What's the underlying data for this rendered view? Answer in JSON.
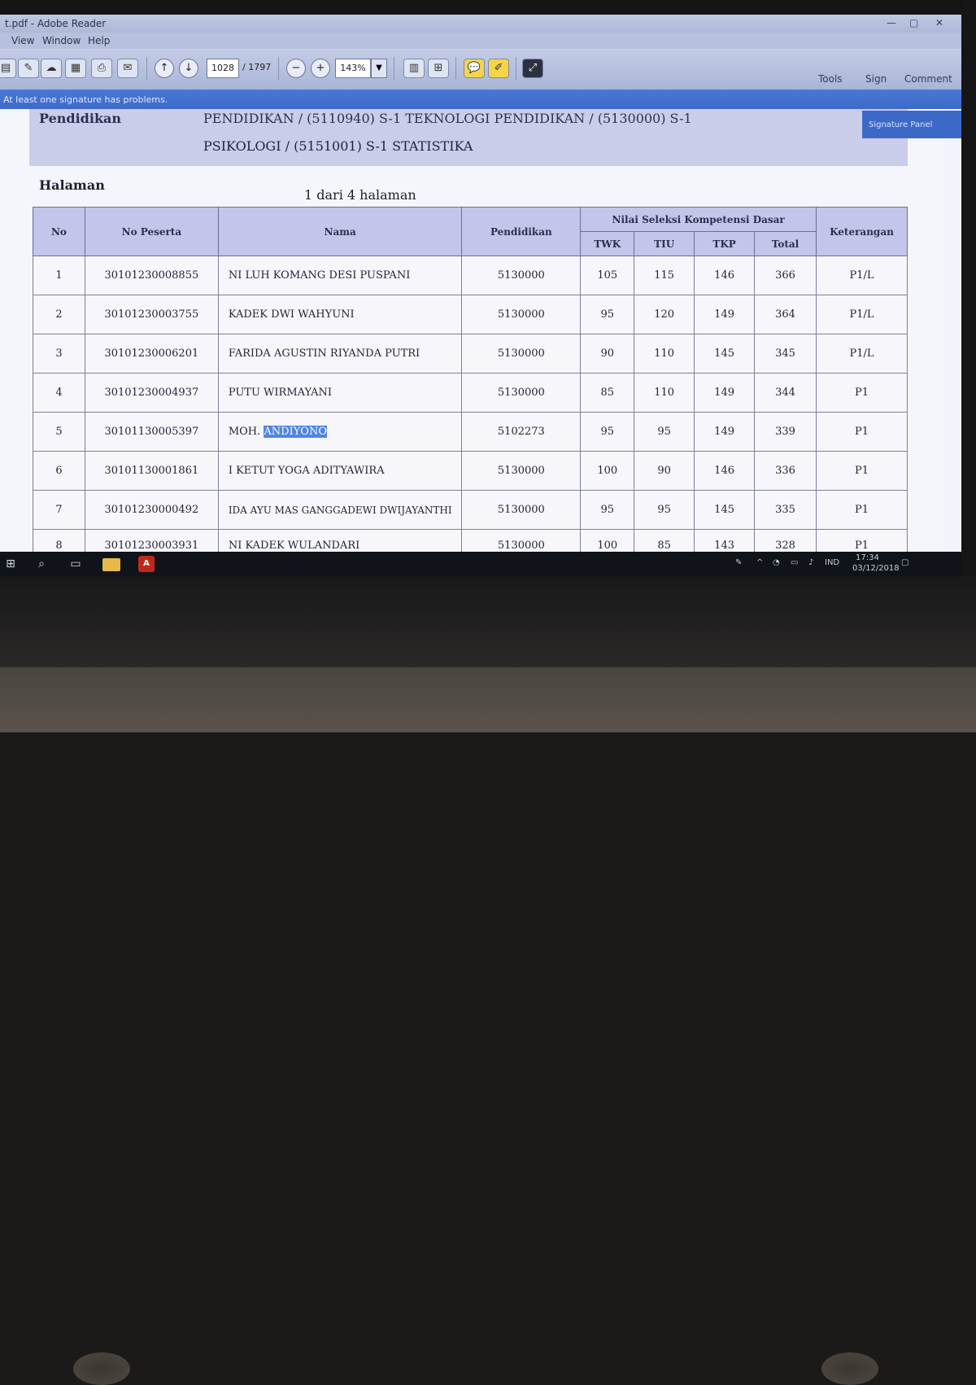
{
  "window": {
    "title": "t.pdf - Adobe Reader"
  },
  "menu": [
    "View",
    "Window",
    "Help"
  ],
  "toolbar": {
    "page_current": "1028",
    "page_total": "/ 1797",
    "zoom": "143%"
  },
  "infobar": {
    "message": "At least one signature has problems.",
    "tools": "Tools",
    "sign": "Sign",
    "comment": "Comment"
  },
  "signature_panel": {
    "label": "Signature Panel"
  },
  "document": {
    "field_label": "Pendidikan",
    "pendidikan_line1": "PENDIDIKAN / (5110940) S-1 TEKNOLOGI PENDIDIKAN / (5130000) S-1",
    "pendidikan_line2": "PSIKOLOGI / (5151001) S-1 STATISTIKA",
    "page_label": "Halaman",
    "page_value": "1    dari 4 halaman"
  },
  "table": {
    "headers": {
      "no": "No",
      "no_peserta": "No Peserta",
      "nama": "Nama",
      "pendidikan": "Pendidikan",
      "group": "Nilai Seleksi Kompetensi Dasar",
      "twk": "TWK",
      "tiu": "TIU",
      "tkp": "TKP",
      "total": "Total",
      "keterangan": "Keterangan"
    },
    "rows": [
      {
        "no": "1",
        "peserta": "30101230008855",
        "nama": "NI LUH KOMANG DESI PUSPANI",
        "pend": "5130000",
        "twk": "105",
        "tiu": "115",
        "tkp": "146",
        "total": "366",
        "ket": "P1/L"
      },
      {
        "no": "2",
        "peserta": "30101230003755",
        "nama": "KADEK DWI WAHYUNI",
        "pend": "5130000",
        "twk": "95",
        "tiu": "120",
        "tkp": "149",
        "total": "364",
        "ket": "P1/L"
      },
      {
        "no": "3",
        "peserta": "30101230006201",
        "nama": "FARIDA AGUSTIN RIYANDA PUTRI",
        "pend": "5130000",
        "twk": "90",
        "tiu": "110",
        "tkp": "145",
        "total": "345",
        "ket": "P1/L"
      },
      {
        "no": "4",
        "peserta": "30101230004937",
        "nama": "PUTU WIRMAYANI",
        "pend": "5130000",
        "twk": "85",
        "tiu": "110",
        "tkp": "149",
        "total": "344",
        "ket": "P1"
      },
      {
        "no": "5",
        "peserta": "30101130005397",
        "nama_pre": "MOH. ",
        "nama_hl": "ANDIYONO",
        "pend": "5102273",
        "twk": "95",
        "tiu": "95",
        "tkp": "149",
        "total": "339",
        "ket": "P1"
      },
      {
        "no": "6",
        "peserta": "30101130001861",
        "nama": "I KETUT YOGA ADITYAWIRA",
        "pend": "5130000",
        "twk": "100",
        "tiu": "90",
        "tkp": "146",
        "total": "336",
        "ket": "P1"
      },
      {
        "no": "7",
        "peserta": "30101230000492",
        "nama": "IDA AYU MAS GANGGADEWI DWIJAYANTHI",
        "pend": "5130000",
        "twk": "95",
        "tiu": "95",
        "tkp": "145",
        "total": "335",
        "ket": "P1"
      },
      {
        "no": "8",
        "peserta": "30101230003931",
        "nama": "NI KADEK WULANDARI",
        "pend": "5130000",
        "twk": "100",
        "tiu": "85",
        "tkp": "143",
        "total": "328",
        "ket": "P1"
      }
    ]
  },
  "taskbar": {
    "lang": "IND",
    "time": "17:34",
    "date": "03/12/2018"
  }
}
